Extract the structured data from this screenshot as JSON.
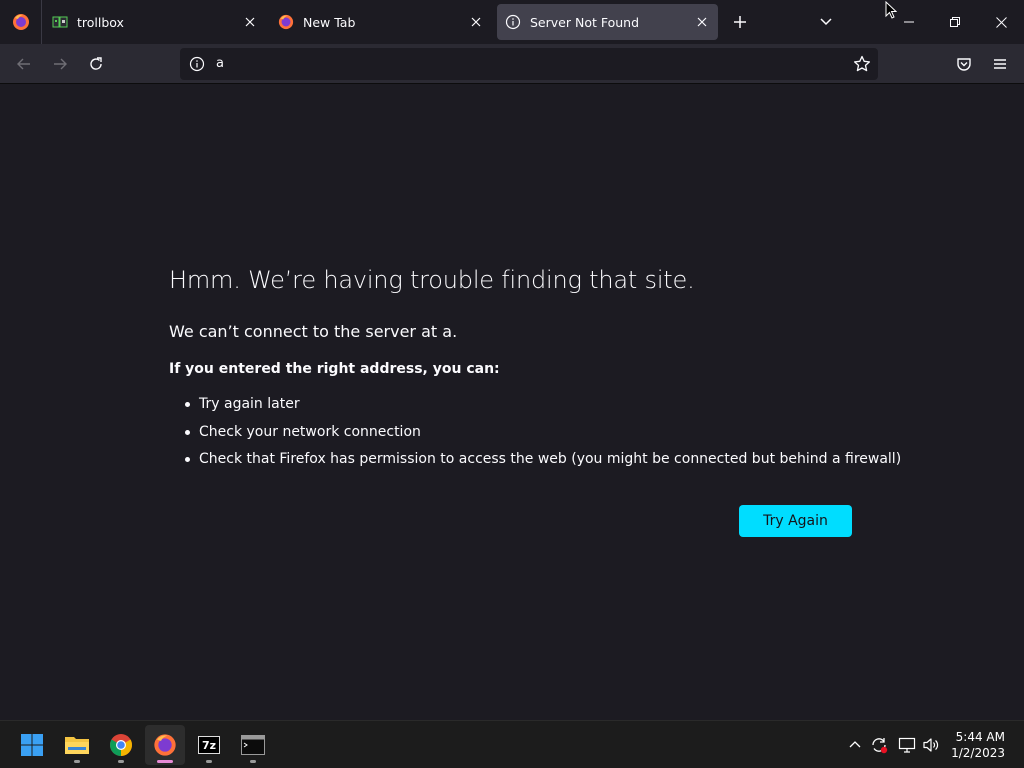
{
  "browser": {
    "tabs": [
      {
        "label": "trollbox",
        "icon": "trollbox-favicon-icon",
        "active": false
      },
      {
        "label": "New Tab",
        "icon": "firefox-icon",
        "active": false
      },
      {
        "label": "Server Not Found",
        "icon": "info-icon",
        "active": true
      }
    ],
    "url": "a"
  },
  "error_page": {
    "title": "Hmm. We’re having trouble finding that site.",
    "description": "We can’t connect to the server at a.",
    "advice_heading": "If you entered the right address, you can:",
    "suggestions": [
      "Try again later",
      "Check your network connection",
      "Check that Firefox has permission to access the web (you might be connected but behind a firewall)"
    ],
    "try_again_label": "Try Again",
    "accent_color": "#00ddff"
  },
  "taskbar": {
    "apps": [
      "start-icon",
      "file-explorer-icon",
      "chrome-icon",
      "firefox-icon",
      "7zip-icon",
      "terminal-icon"
    ],
    "clock": {
      "time": "5:44 AM",
      "date": "1/2/2023"
    },
    "sevenzip_label": "7z"
  }
}
